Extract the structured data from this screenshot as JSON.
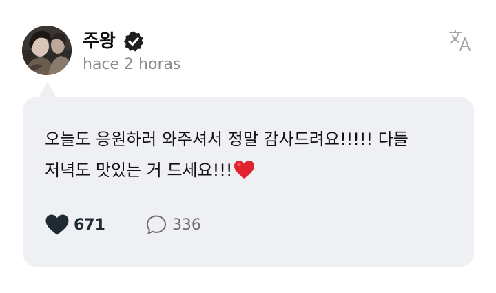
{
  "post": {
    "author_name": "주왕",
    "verified": true,
    "timestamp": "hace 2 horas",
    "message_text": "오늘도 응원하러 와주셔서 정말 감사드려요!!!!! 다들\n저녁도 맛있는 거 드세요!!!",
    "message_emoji": "red-heart",
    "likes": "671",
    "comments": "336"
  },
  "icons": {
    "verified": "verified-badge-icon",
    "translate": "translate-icon",
    "like": "heart-icon",
    "comment": "comment-bubble-icon"
  },
  "colors": {
    "bubble_background": "#eff0f3",
    "text_primary": "#111111",
    "timestamp": "#8c8c8c",
    "like_icon": "#1f2a33",
    "emoji_heart": "#e0242f"
  }
}
